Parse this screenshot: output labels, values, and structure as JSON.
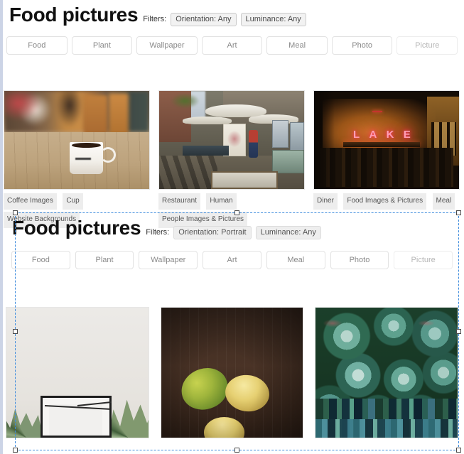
{
  "sections": [
    {
      "title": "Food pictures",
      "filters_label": "Filters:",
      "filters": [
        {
          "name": "orientation-filter",
          "label": "Orientation: Any"
        },
        {
          "name": "luminance-filter",
          "label": "Luminance: Any"
        }
      ],
      "tabs": [
        "Food",
        "Plant",
        "Wallpaper",
        "Art",
        "Meal",
        "Photo",
        "Picture"
      ],
      "cards": [
        {
          "image": "coffee-mug-on-wooden-table",
          "tags": [
            "Coffee Images",
            "Cup",
            "Website Backgrounds"
          ]
        },
        {
          "image": "outdoor-art-market-with-umbrellas",
          "tags": [
            "Restaurant",
            "Human",
            "People Images & Pictures"
          ]
        },
        {
          "image": "dark-interior-with-lake-neon-sign",
          "tags": [
            "Diner",
            "Food Images & Pictures",
            "Meal"
          ],
          "neon_text": [
            "L",
            "A",
            "K",
            "E"
          ]
        }
      ]
    },
    {
      "title": "Food pictures",
      "filters_label": "Filters:",
      "filters": [
        {
          "name": "orientation-filter",
          "label": "Orientation: Portrait"
        },
        {
          "name": "luminance-filter",
          "label": "Luminance: Any"
        }
      ],
      "tabs": [
        "Food",
        "Plant",
        "Wallpaper",
        "Art",
        "Meal",
        "Photo",
        "Picture"
      ],
      "cards": [
        {
          "image": "black-picture-frame-with-pineapple-leaves",
          "tags": []
        },
        {
          "image": "lemons-and-lime-on-dark-wood",
          "tags": []
        },
        {
          "image": "green-succulents-with-loading-glitch",
          "tags": []
        }
      ],
      "selected": true
    }
  ],
  "colors": {
    "selection_border": "#3d8bdd",
    "chip_background": "#ededed",
    "tab_text": "#8a8a8a"
  }
}
